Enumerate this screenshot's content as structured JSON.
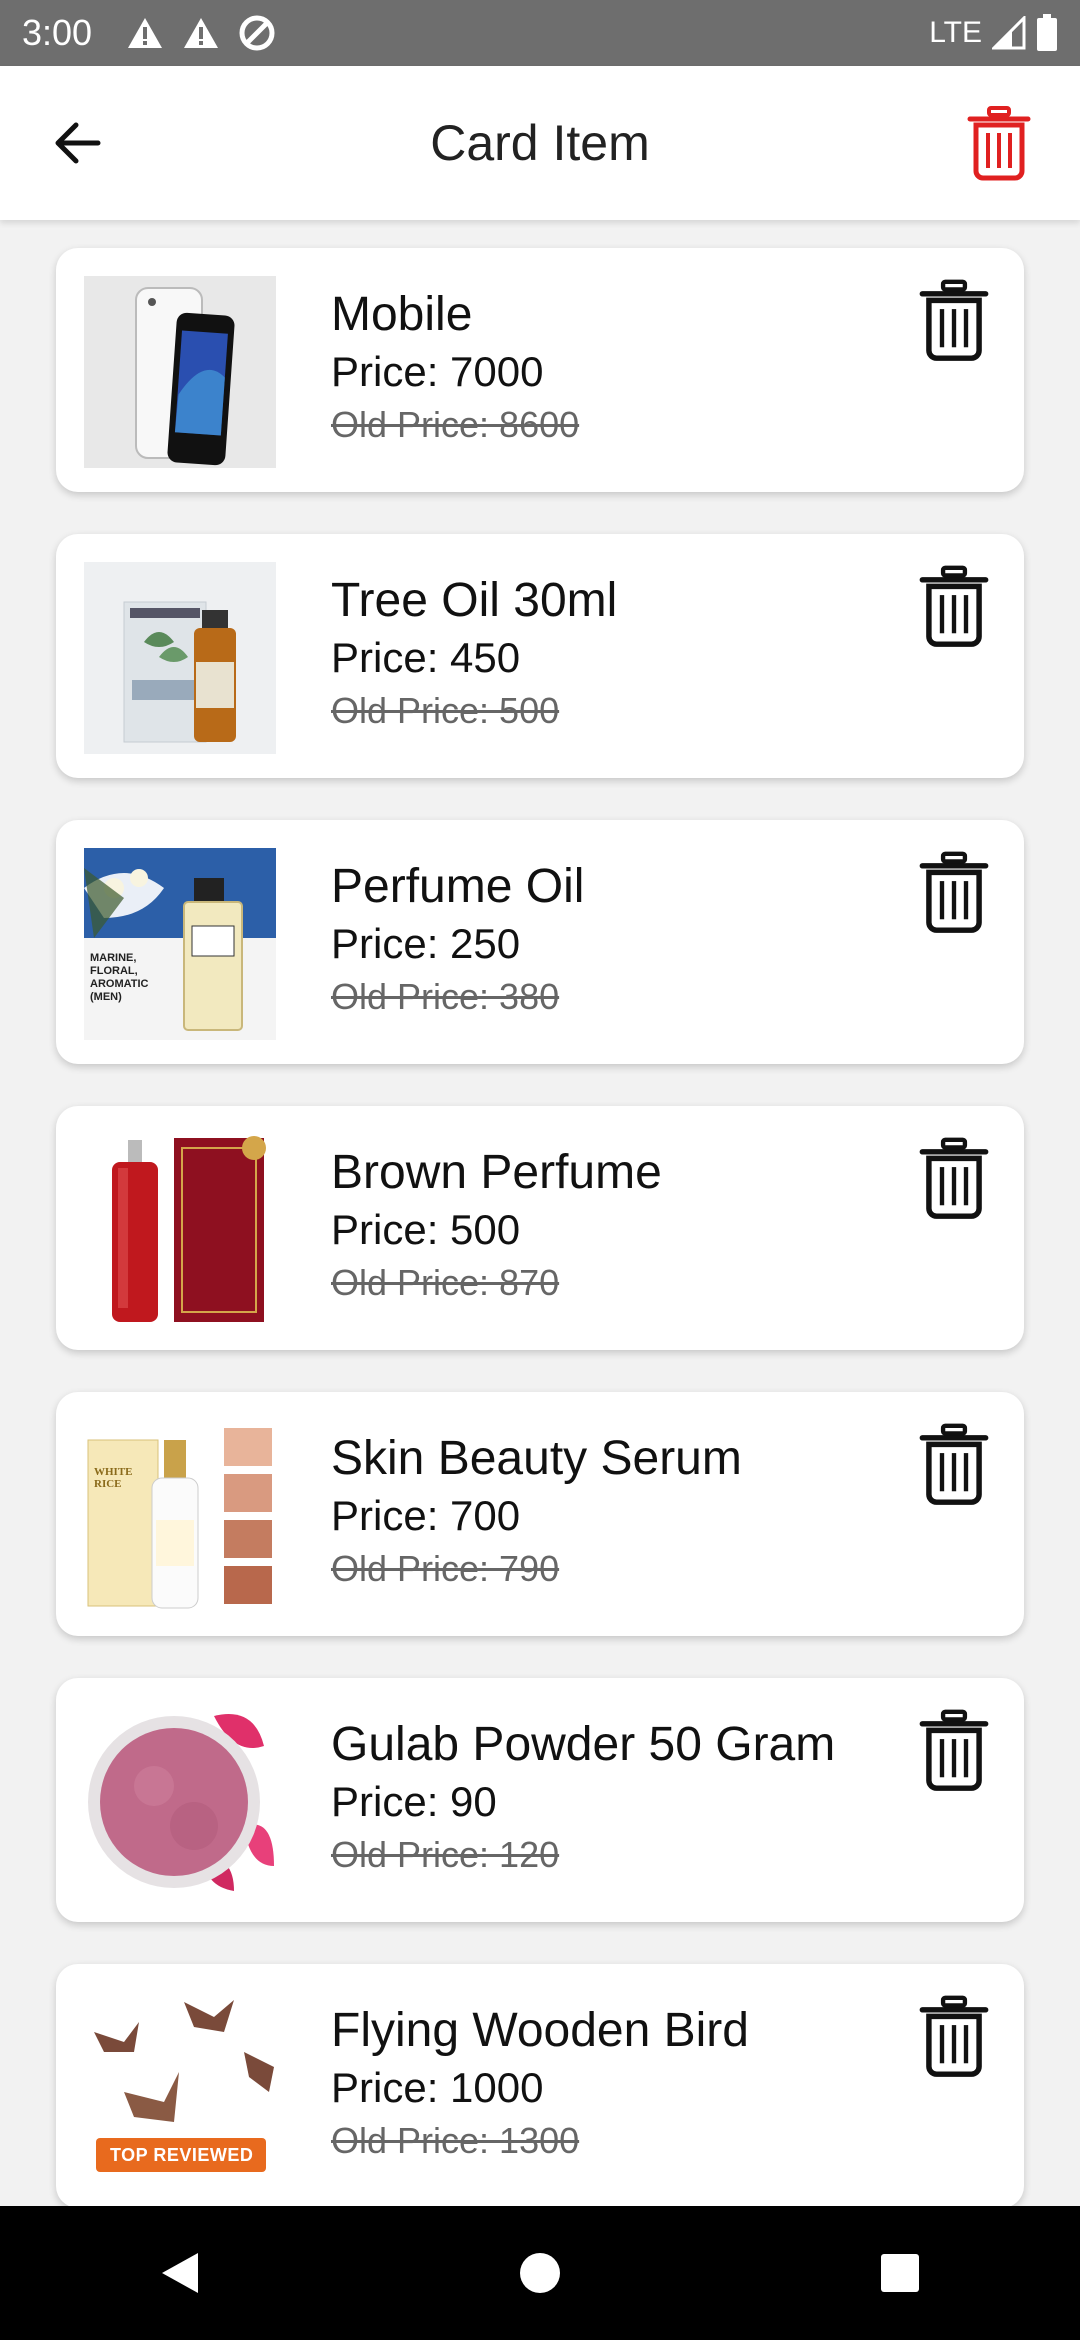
{
  "status_bar": {
    "time": "3:00",
    "network": "LTE",
    "icons": [
      "warning-icon",
      "warning-icon",
      "data-saver-icon",
      "signal-icon",
      "battery-icon"
    ]
  },
  "app_bar": {
    "title": "Card Item",
    "back_icon": "arrow-left-icon",
    "clear_icon": "trash-icon",
    "accent_color": "#e02020"
  },
  "items": [
    {
      "name": "Mobile",
      "price": "Price: 7000",
      "old_price": "Old Price: 8600",
      "image": "phone"
    },
    {
      "name": "Tree Oil 30ml",
      "price": "Price: 450",
      "old_price": "Old Price: 500",
      "image": "tea-tree-oil"
    },
    {
      "name": "Perfume Oil",
      "price": "Price: 250",
      "old_price": "Old Price: 380",
      "image": "perfume-oil"
    },
    {
      "name": "Brown Perfume",
      "price": "Price: 500",
      "old_price": "Old Price: 870",
      "image": "brown-perfume"
    },
    {
      "name": "Skin Beauty Serum",
      "price": "Price: 700",
      "old_price": "Old Price: 790",
      "image": "serum"
    },
    {
      "name": "Gulab Powder 50 Gram",
      "price": "Price: 90",
      "old_price": "Old Price: 120",
      "image": "rose-powder"
    },
    {
      "name": "Flying Wooden Bird",
      "price": "Price: 1000",
      "old_price": "Old Price: 1300",
      "image": "wooden-birds"
    }
  ],
  "image_text": {
    "perfume_oil_caption": "MARINE, FLORAL, AROMATIC (MEN)",
    "bird_badge": "TOP REVIEWED",
    "serum_brand": "WHITE RICE"
  },
  "nav_bar": {
    "icons": [
      "back-triangle-icon",
      "home-circle-icon",
      "recents-square-icon"
    ]
  }
}
